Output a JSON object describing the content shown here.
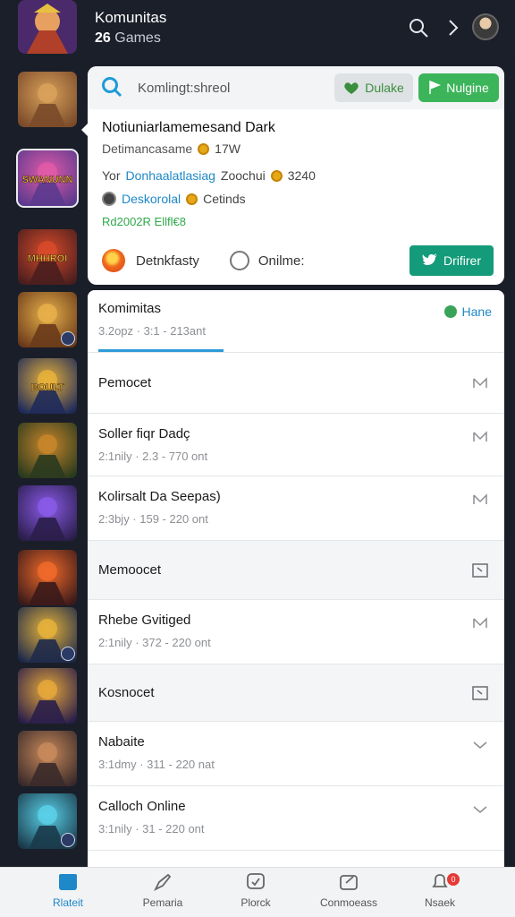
{
  "header": {
    "title": "Komunitas",
    "count": "26",
    "count_label": "Games"
  },
  "thumbnails": [
    {
      "name": "game-1",
      "colors": [
        "#7a4a2a",
        "#d9a15a"
      ]
    },
    {
      "name": "game-2",
      "colors": [
        "#5b3a8e",
        "#e25aa8"
      ],
      "label": "SWANUNN"
    },
    {
      "name": "game-3",
      "colors": [
        "#4a1e1e",
        "#d84a2a"
      ],
      "label": "MHHROI"
    },
    {
      "name": "game-4",
      "colors": [
        "#6a3a1a",
        "#e7b04a"
      ]
    },
    {
      "name": "game-5",
      "colors": [
        "#1e2a5a",
        "#e8b23a"
      ],
      "label": "BOULT"
    },
    {
      "name": "game-6",
      "colors": [
        "#2a3a1e",
        "#c8862a"
      ]
    },
    {
      "name": "game-7",
      "colors": [
        "#2a1e4a",
        "#8a5ae8"
      ]
    },
    {
      "name": "game-8",
      "colors": [
        "#3a1a1a",
        "#f06a2a"
      ]
    },
    {
      "name": "game-9",
      "colors": [
        "#1e2a4a",
        "#e6b23a"
      ]
    },
    {
      "name": "game-10",
      "colors": [
        "#2a1e4a",
        "#e6a83a"
      ]
    },
    {
      "name": "game-11",
      "colors": [
        "#3a2a2a",
        "#c88a5a"
      ]
    },
    {
      "name": "game-12",
      "colors": [
        "#1a3a4a",
        "#5ad0e8"
      ]
    }
  ],
  "search": {
    "placeholder": "Komlingt:shreol",
    "like_label": "Dulake",
    "green_label": "Nulgine"
  },
  "card": {
    "title": "Notiuniarlamemesand Dark",
    "line1_label": "Detimancasame",
    "line1_value": "17W",
    "line2_prefix": "Yor",
    "line2_link": "Donhaalatlasiag",
    "line2_mid": "Zoochui",
    "line2_value": "3240",
    "line3_link": "Deskorolal",
    "line3_value": "Cetinds",
    "green_text": "Rd2002R Ellfl€8",
    "radio1": "Detnkfasty",
    "radio2": "Onilme:",
    "button": "Drifirer"
  },
  "list": {
    "header_title": "Komimitas",
    "header_sub": "3.2opz · 3:1 - 213ant",
    "hane_label": "Hane",
    "rows": [
      {
        "title": "Pemocet",
        "sub": "",
        "icon": "mail"
      },
      {
        "title": "Soller fiqr Dadç",
        "sub": "2:1nily · 2.3 - 770 ont",
        "icon": "mail"
      },
      {
        "title": "Kolirsalt Da Seepas)",
        "sub": "2:3bjy · 159 - 220 ont",
        "icon": "mail"
      },
      {
        "title": "Memoocet",
        "sub": "",
        "icon": "box"
      },
      {
        "title": "Rhebe Gvitiged",
        "sub": "2:1nily · 372 - 220 ont",
        "icon": "mail"
      },
      {
        "title": "Kosnocet",
        "sub": "",
        "icon": "box"
      },
      {
        "title": "Nabaite",
        "sub": "3:1dmy · 311 - 220 nat",
        "icon": "chevron"
      },
      {
        "title": "Calloch Online",
        "sub": "3:1nily · 31 - 220 ont",
        "icon": "chevron"
      }
    ]
  },
  "nav": {
    "items": [
      "Rlateit",
      "Pemaria",
      "Plorck",
      "Conmoeass",
      "Nsaek"
    ],
    "badge": "0"
  },
  "colors": {
    "accent": "#1e88c8",
    "green": "#3cb55a",
    "teal": "#139b7a",
    "bg_dark": "#1a1e29"
  }
}
